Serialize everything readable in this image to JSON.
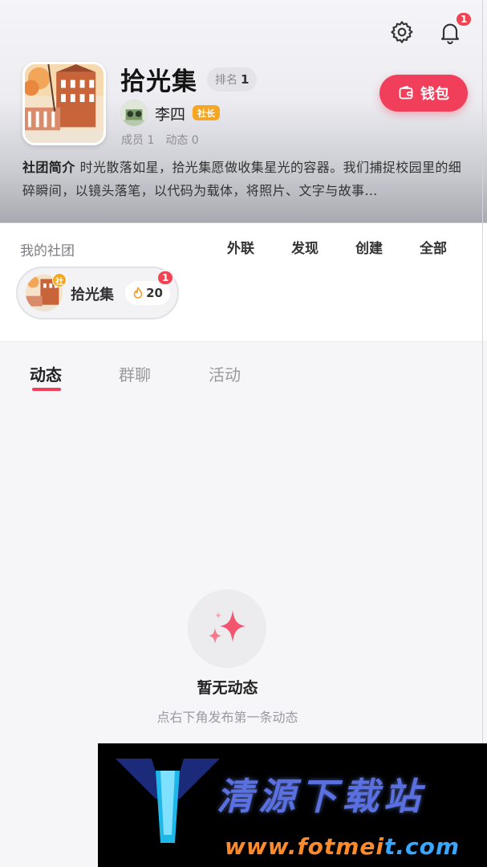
{
  "header": {
    "notification_count": "1",
    "club": {
      "name": "拾光集",
      "rank_label": "排名",
      "rank_value": "1",
      "owner_name": "李四",
      "owner_tag": "社长",
      "members": "成员 1",
      "posts": "动态 0",
      "intro_label": "社团简介",
      "intro_text": "时光散落如星，拾光集愿做收集星光的容器。我们捕捉校园里的细碎瞬间，以镜头落笔，以代码为载体，将照片、文字与故事…"
    },
    "wallet_label": "钱包"
  },
  "my_clubs": {
    "title": "我的社团",
    "links": [
      "外联",
      "发现",
      "创建",
      "全部"
    ],
    "chip": {
      "tag": "社",
      "name": "拾光集",
      "heat": "20",
      "badge": "1"
    }
  },
  "tabs": [
    "动态",
    "群聊",
    "活动"
  ],
  "active_tab": "动态",
  "empty_state": {
    "title": "暂无动态",
    "subtitle": "点右下角发布第一条动态"
  },
  "watermark": {
    "title": "清源下载站",
    "url_part1": "www.fotmei",
    "url_part2": "t.com"
  },
  "colors": {
    "accent": "#f13e5a",
    "badge": "#f04452",
    "owner_tag": "#f5a623"
  }
}
